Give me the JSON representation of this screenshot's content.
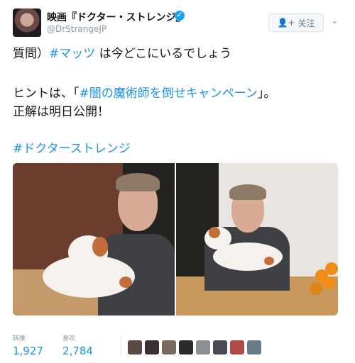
{
  "account": {
    "display_name": "映画『ドクター・ストレンジ』",
    "handle": "@DrStrangeJP",
    "verified_glyph": "✓",
    "follow_label": "关注"
  },
  "tweet": {
    "line1_prefix": "質問）",
    "line1_hashtag": "#マッツ",
    "line1_suffix": " は今どこにいるでしょう",
    "line2_prefix": "ヒントは、「",
    "line2_hashtag": "#闇の魔術師を倒せキャンペーン",
    "line2_suffix": "」。",
    "line3": "正解は明日公開！",
    "hashtag_line": "#ドクターストレンジ"
  },
  "stats": {
    "retweets_label": "转推",
    "retweets_value": "1,927",
    "likes_label": "喜欢",
    "likes_value": "2,784"
  },
  "icons": {
    "follow": "person-plus-icon",
    "menu": "chevron-down-icon",
    "verified": "verified-icon"
  },
  "colors": {
    "link": "#1b95e0",
    "verified": "#1da1f2",
    "muted": "#8899a6"
  }
}
